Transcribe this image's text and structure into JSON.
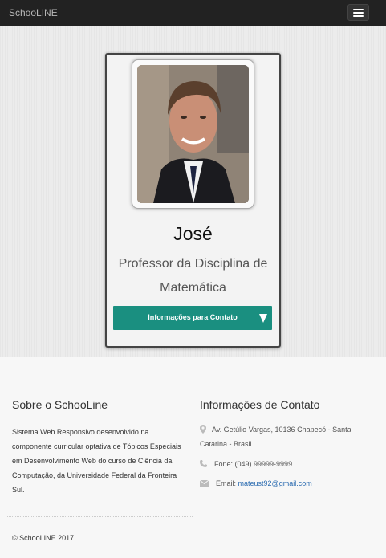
{
  "navbar": {
    "brand": "SchooLINE",
    "menu_icon": "hamburger-icon"
  },
  "profile": {
    "name": "José",
    "role": "Professor da Disciplina de Matemática",
    "contact_button_label": "Informações para Contato",
    "contact_button_icon": "caret-down-icon"
  },
  "footer": {
    "about_title": "Sobre o SchooLine",
    "about_text": "Sistema Web Responsivo desenvolvido na componente curricular optativa de Tópicos Especiais em Desenvolvimento Web do curso de Ciência da Computação, da Universidade Federal da Fronteira Sul.",
    "contact_title": "Informações de Contato",
    "address": "Av. Getúlio Vargas, 10136 Chapecó - Santa Catarina - Brasil",
    "phone": "Fone: (049) 99999-9999",
    "email_label": "Email:",
    "email": "mateust92@gmail.com",
    "copyright": "© SchooLINE 2017"
  },
  "colors": {
    "navbar": "#222222",
    "accent_button": "#1a8f80",
    "link": "#2a6bb0"
  }
}
